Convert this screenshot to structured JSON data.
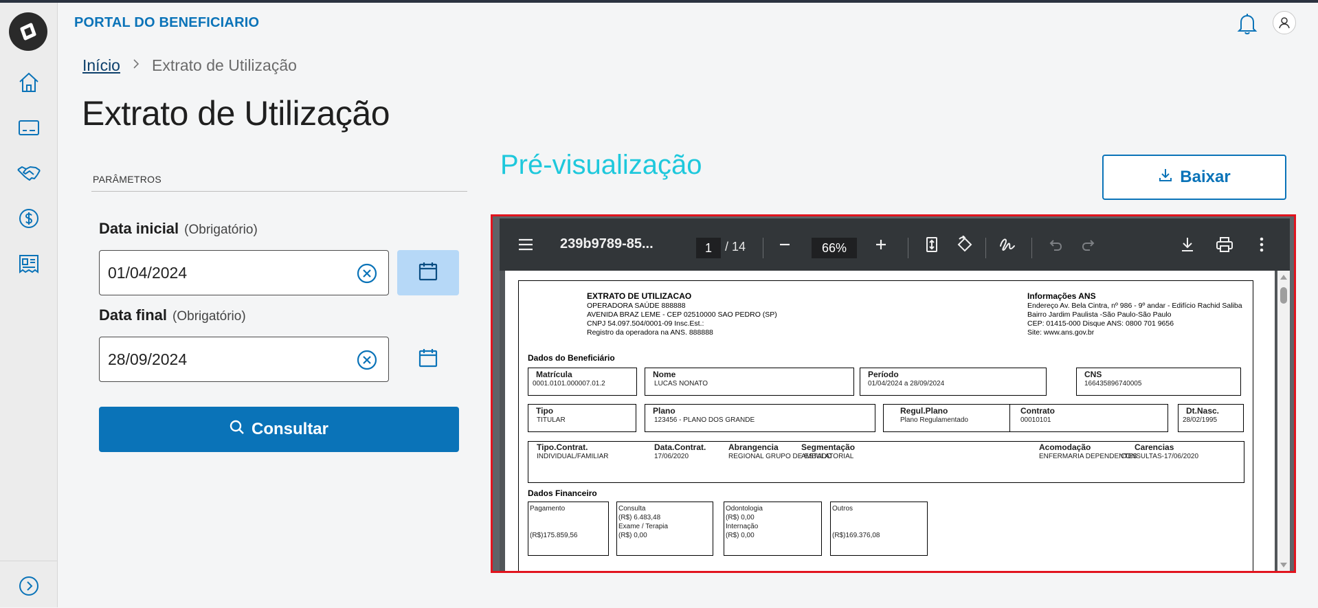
{
  "app": {
    "title": "PORTAL DO BENEFICIARIO"
  },
  "sidebar": {
    "items": [
      {
        "icon": "home-icon"
      },
      {
        "icon": "card-icon"
      },
      {
        "icon": "handshake-icon"
      },
      {
        "icon": "dollar-icon"
      },
      {
        "icon": "receipt-icon"
      }
    ]
  },
  "breadcrumb": {
    "home": "Início",
    "current": "Extrato de Utilização"
  },
  "page": {
    "title": "Extrato de Utilização"
  },
  "params": {
    "section": "PARÂMETROS",
    "start": {
      "label": "Data inicial",
      "hint": "(Obrigatório)",
      "value": "01/04/2024"
    },
    "end": {
      "label": "Data final",
      "hint": "(Obrigatório)",
      "value": "28/09/2024"
    },
    "submit": "Consultar"
  },
  "preview": {
    "title": "Pré-visualização",
    "download": "Baixar",
    "viewer": {
      "doc_name": "239b9789-85...",
      "page": "1",
      "total": "/ 14",
      "zoom": "66%"
    },
    "pdf": {
      "title": "EXTRATO DE UTILIZACAO",
      "op_lines": [
        "OPERADORA SAÚDE 888888",
        "AVENIDA BRAZ LEME - CEP 02510000 SAO PEDRO (SP)",
        "CNPJ 54.097.504/0001-09  Insc.Est.:",
        "Registro da operadora na ANS. 888888"
      ],
      "ans_title": "Informações ANS",
      "ans_lines": [
        "Endereço Av. Bela Cintra, nº 986 - 9º andar - Edifício Rachid Saliba",
        "Bairro Jardim Paulista -São Paulo-São Paulo",
        "CEP: 01415-000 Disque ANS: 0800 701 9656",
        "Site: www.ans.gov.br"
      ],
      "benef_title": "Dados do Beneficiário",
      "matricula": {
        "h": "Matrícula",
        "v": "0001.0101.000007.01.2"
      },
      "nome": {
        "h": "Nome",
        "v": "LUCAS NONATO"
      },
      "periodo": {
        "h": "Período",
        "v": "01/04/2024 a 28/09/2024"
      },
      "cns": {
        "h": "CNS",
        "v": "166435896740005"
      },
      "tipo": {
        "h": "Tipo",
        "v": "TITULAR"
      },
      "plano": {
        "h": "Plano",
        "v": "123456      - PLANO DOS GRANDE"
      },
      "regul": {
        "h": "Regul.Plano",
        "v": "Plano Regulamentado"
      },
      "contrato": {
        "h": "Contrato",
        "v": "00010101"
      },
      "dtnasc": {
        "h": "Dt.Nasc.",
        "v": "28/02/1995"
      },
      "tipocontrat": {
        "h": "Tipo.Contrat.",
        "v": "INDIVIDUAL/FAMILIAR"
      },
      "datacontrat": {
        "h": "Data.Contrat.",
        "v": "17/06/2020"
      },
      "abrangencia": {
        "h": "Abrangencia",
        "v": "REGIONAL GRUPO DE ESTADO"
      },
      "segmentacao": {
        "h": "Segmentação",
        "v": "AMBULATORIAL"
      },
      "acomodacao": {
        "h": "Acomodação",
        "v": "ENFERMARIA DEPENDENTES"
      },
      "carencias": {
        "h": "Carencias",
        "v": "CONSULTAS-17/06/2020"
      },
      "fin_title": "Dados Financeiro",
      "pagamento": {
        "h": "Pagamento",
        "v": "(R$)175.859,56"
      },
      "consulta": {
        "h": "Consulta",
        "v1": "(R$)  6.483,48",
        "h2": "Exame / Terapia",
        "v2": "(R$)      0,00"
      },
      "odonto": {
        "h": "Odontologia",
        "v1": "(R$)      0,00",
        "h2": "Internação",
        "v2": "(R$)      0,00"
      },
      "outros": {
        "h": "Outros",
        "v": "(R$)169.376,08"
      }
    }
  }
}
